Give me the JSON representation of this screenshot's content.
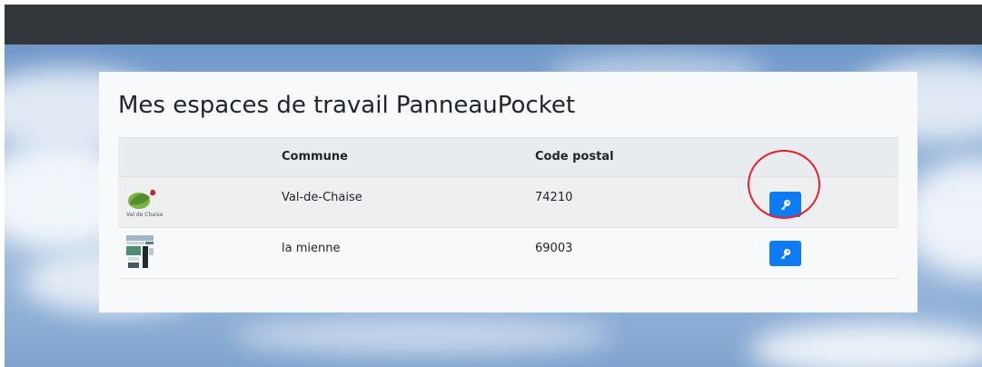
{
  "page": {
    "title": "Mes espaces de travail PanneauPocket"
  },
  "table": {
    "headers": {
      "logo": "",
      "commune": "Commune",
      "postal": "Code postal",
      "action": ""
    },
    "rows": [
      {
        "logo_caption": "Val de Chaise",
        "commune": "Val-de-Chaise",
        "postal": "74210",
        "action_icon": "key-icon"
      },
      {
        "logo_caption": "",
        "commune": "la mienne",
        "postal": "69003",
        "action_icon": "key-icon"
      }
    ]
  },
  "colors": {
    "topbar": "#33363b",
    "button": "#0d7cf2",
    "highlight": "#e8202a"
  }
}
